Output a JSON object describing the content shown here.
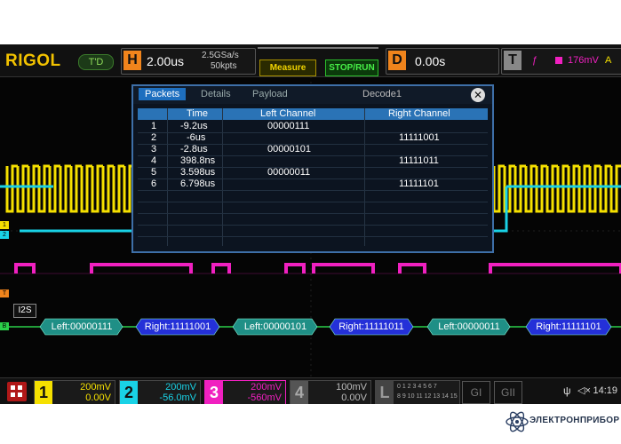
{
  "header": {
    "logo": "RIGOL",
    "trigger_state": "T'D",
    "horizontal": {
      "badge": "H",
      "timebase": "2.00us",
      "sample_rate": "2.5GSa/s",
      "memory_depth": "50kpts"
    },
    "measure_button": "Measure",
    "run_stop_button": "STOP/RUN",
    "delay": {
      "badge": "D",
      "value": "0.00s"
    },
    "trigger": {
      "badge": "T",
      "source_icon": "edge-icon",
      "level": "176mV",
      "channel": "A"
    }
  },
  "decode_dialog": {
    "tabs": [
      "Packets",
      "Details",
      "Payload"
    ],
    "title": "Decode1",
    "close_label": "✕",
    "columns": [
      "Time",
      "Left Channel",
      "Right Channel"
    ],
    "rows": [
      {
        "index": "1",
        "time": "-9.2us",
        "left": "00000111",
        "right": ""
      },
      {
        "index": "2",
        "time": "-6us",
        "left": "",
        "right": "11111001"
      },
      {
        "index": "3",
        "time": "-2.8us",
        "left": "00000101",
        "right": ""
      },
      {
        "index": "4",
        "time": "398.8ns",
        "left": "",
        "right": "11111011"
      },
      {
        "index": "5",
        "time": "3.598us",
        "left": "00000011",
        "right": ""
      },
      {
        "index": "6",
        "time": "6.798us",
        "left": "",
        "right": "11111101"
      }
    ]
  },
  "bus": {
    "name": "I2S",
    "packets": [
      "Left:00000111",
      "Right:11111001",
      "Left:00000101",
      "Right:11111011",
      "Left:00000011",
      "Right:11111101"
    ]
  },
  "channels": [
    {
      "num": "1",
      "scale": "200mV",
      "offset": "0.00V",
      "color": "#f5e000"
    },
    {
      "num": "2",
      "scale": "200mV",
      "offset": "-56.0mV",
      "color": "#19d2e6"
    },
    {
      "num": "3",
      "scale": "200mV",
      "offset": "-560mV",
      "color": "#f020c0"
    },
    {
      "num": "4",
      "scale": "100mV",
      "offset": "0.00V",
      "color": "#777777"
    }
  ],
  "logic": {
    "badge": "L",
    "bits_row1": "0 1 2 3 4 5 6 7",
    "bits_row2": "8 9 10 11 12 13 14 15"
  },
  "generators": [
    "GI",
    "GII"
  ],
  "status": {
    "clock": "14:19"
  },
  "watermark": "ЭЛЕКТРОНПРИБОР"
}
